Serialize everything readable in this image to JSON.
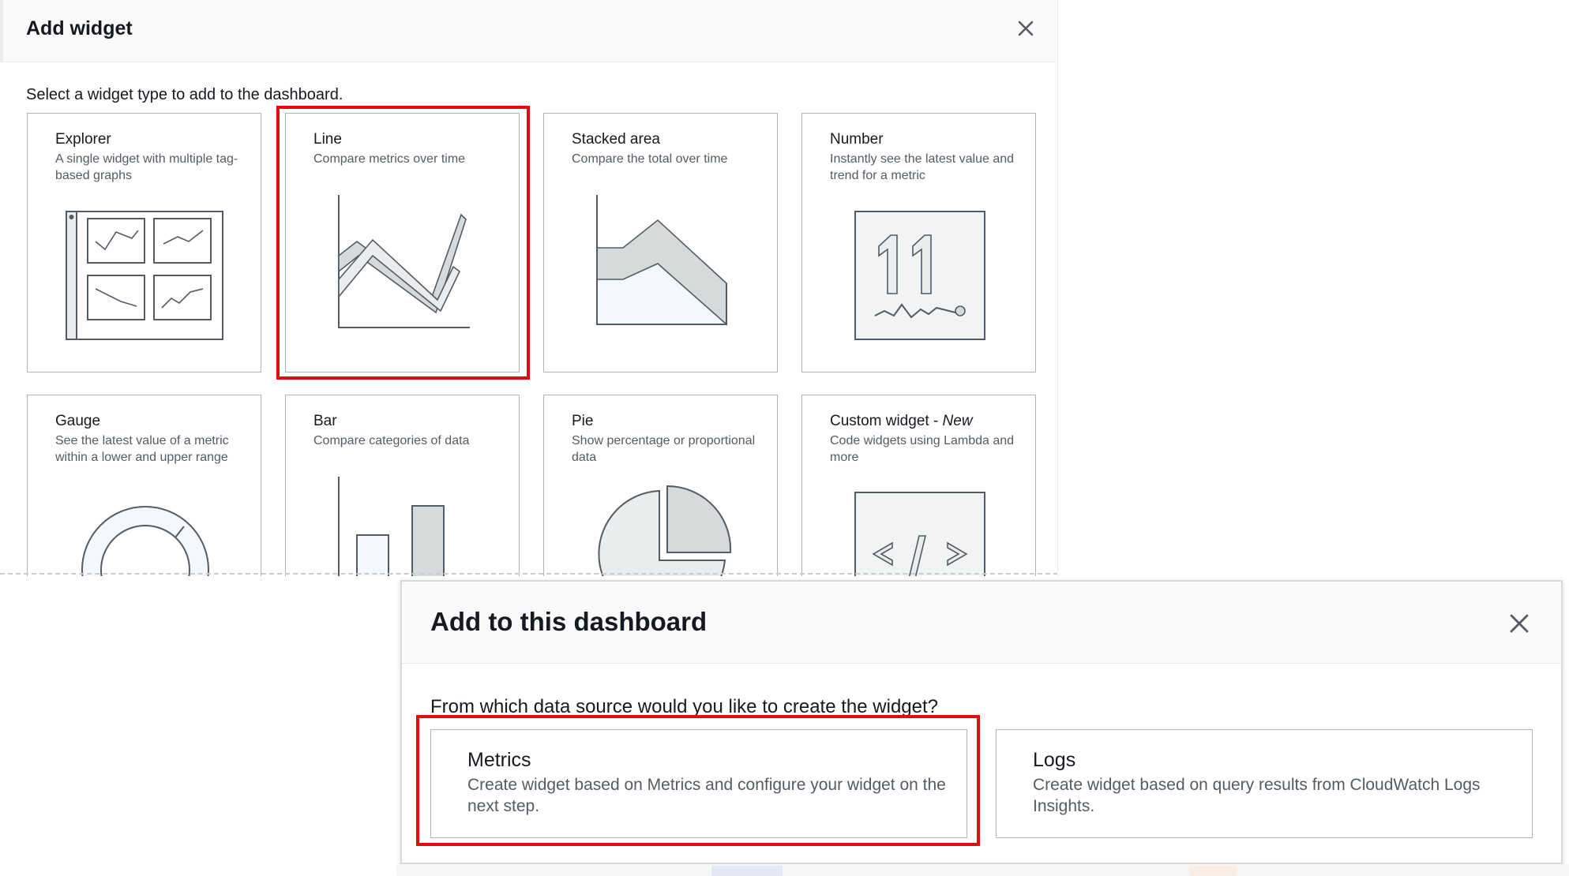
{
  "add_widget": {
    "title": "Add widget",
    "instruction": "Select a widget type to add to the dashboard.",
    "close_icon": "close-icon",
    "cards": [
      {
        "title": "Explorer",
        "description": "A single widget with multiple tag-based graphs",
        "icon": "explorer-grid-icon"
      },
      {
        "title": "Line",
        "description": "Compare metrics over time",
        "icon": "line-chart-icon",
        "highlighted": true
      },
      {
        "title": "Stacked area",
        "description": "Compare the total over time",
        "icon": "stacked-area-icon"
      },
      {
        "title": "Number",
        "description": "Instantly see the latest value and trend for a metric",
        "icon": "number-icon",
        "icon_text": "11"
      },
      {
        "title": "Gauge",
        "description": "See the latest value of a metric within a lower and upper range",
        "icon": "gauge-icon"
      },
      {
        "title": "Bar",
        "description": "Compare categories of data",
        "icon": "bar-chart-icon"
      },
      {
        "title": "Pie",
        "description": "Show percentage or proportional data",
        "icon": "pie-chart-icon"
      },
      {
        "title": "Custom widget - ",
        "title_emphasis": "New",
        "description": "Code widgets using Lambda and more",
        "icon": "code-icon"
      }
    ]
  },
  "add_to_dashboard": {
    "title": "Add to this dashboard",
    "question": "From which data source would you like to create the widget?",
    "close_icon": "close-icon",
    "sources": [
      {
        "title": "Metrics",
        "description": "Create widget based on Metrics and configure your widget on the next step.",
        "highlighted": true
      },
      {
        "title": "Logs",
        "description": "Create widget based on query results from CloudWatch Logs Insights."
      }
    ]
  },
  "colors": {
    "highlight": "#e00d0d",
    "text": "#16191f",
    "secondary_text": "#545b64",
    "border": "#aab7b8",
    "icon_fill": "#d5dbdb",
    "icon_light_fill": "#f2f8fd"
  }
}
